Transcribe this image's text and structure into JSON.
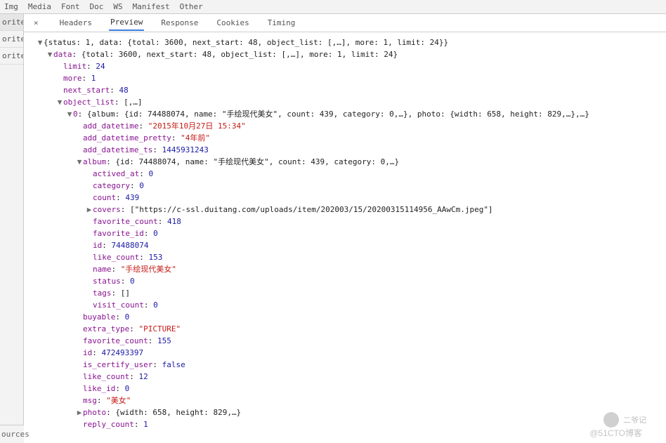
{
  "top_tabs": [
    "Img",
    "Media",
    "Font",
    "Doc",
    "WS",
    "Manifest",
    "Other"
  ],
  "sidebar": {
    "items": [
      "orite...",
      "orite...",
      "orite..."
    ],
    "bottom": "ources"
  },
  "sub_tabs": {
    "close": "×",
    "items": [
      "Headers",
      "Preview",
      "Response",
      "Cookies",
      "Timing"
    ],
    "active": 1
  },
  "tree": {
    "root_summary": "{status: 1, data: {total: 3600, next_start: 48, object_list: [,…], more: 1, limit: 24}}",
    "data_key": "data",
    "data_summary": "{total: 3600, next_start: 48, object_list: [,…], more: 1, limit: 24}",
    "limit_k": "limit",
    "limit_v": "24",
    "more_k": "more",
    "more_v": "1",
    "next_k": "next_start",
    "next_v": "48",
    "ol_k": "object_list",
    "ol_v": "[,…]",
    "idx0_k": "0",
    "idx0_summary": "{album: {id: 74488074, name: \"手绘现代美女\", count: 439, category: 0,…}, photo: {width: 658, height: 829,…},…}",
    "adt_k": "add_datetime",
    "adt_v": "\"2015年10月27日 15:34\"",
    "adtp_k": "add_datetime_pretty",
    "adtp_v": "\"4年前\"",
    "adts_k": "add_datetime_ts",
    "adts_v": "1445931243",
    "album_k": "album",
    "album_summary": "{id: 74488074, name: \"手绘现代美女\", count: 439, category: 0,…}",
    "act_k": "actived_at",
    "act_v": "0",
    "cat_k": "category",
    "cat_v": "0",
    "cnt_k": "count",
    "cnt_v": "439",
    "cov_k": "covers",
    "cov_v": "[\"https://c-ssl.duitang.com/uploads/item/202003/15/20200315114956_AAwCm.jpeg\"]",
    "fav_k": "favorite_count",
    "fav_v": "418",
    "fid_k": "favorite_id",
    "fid_v": "0",
    "aid_k": "id",
    "aid_v": "74488074",
    "like_k": "like_count",
    "like_v": "153",
    "nm_k": "name",
    "nm_v": "\"手绘现代美女\"",
    "st_k": "status",
    "st_v": "0",
    "tg_k": "tags",
    "tg_v": "[]",
    "vc_k": "visit_count",
    "vc_v": "0",
    "buy_k": "buyable",
    "buy_v": "0",
    "ext_k": "extra_type",
    "ext_v": "\"PICTURE\"",
    "fav2_k": "favorite_count",
    "fav2_v": "155",
    "id2_k": "id",
    "id2_v": "472493397",
    "cert_k": "is_certify_user",
    "cert_v": "false",
    "lk2_k": "like_count",
    "lk2_v": "12",
    "lkid_k": "like_id",
    "lkid_v": "0",
    "msg_k": "msg",
    "msg_v": "\"美女\"",
    "ph_k": "photo",
    "ph_v": "{width: 658, height: 829,…}",
    "rc_k": "reply_count",
    "rc_v": "1"
  },
  "watermark": {
    "title": "二爷记",
    "sub": "@51CTO博客"
  }
}
